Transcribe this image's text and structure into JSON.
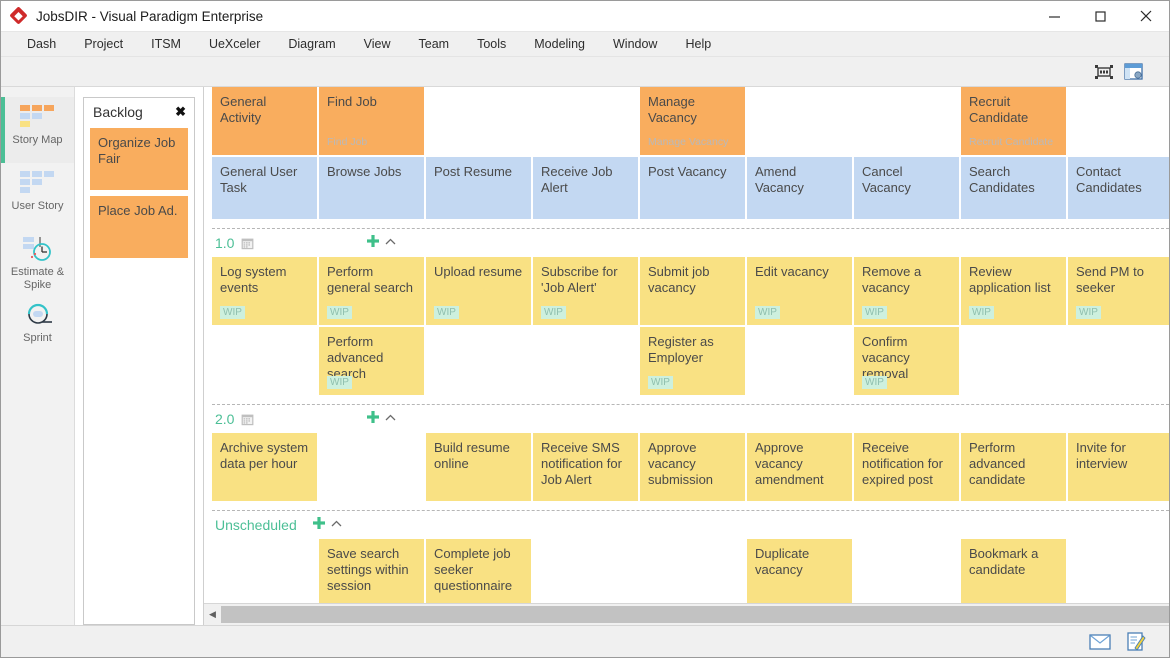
{
  "window": {
    "title": "JobsDIR - Visual Paradigm Enterprise",
    "logo_icon": "vp-diamond-logo",
    "minimize_icon": "minimize-icon",
    "maximize_icon": "maximize-icon",
    "close_icon": "close-icon"
  },
  "menubar": {
    "items": [
      {
        "label": "Dash"
      },
      {
        "label": "Project"
      },
      {
        "label": "ITSM"
      },
      {
        "label": "UeXceler"
      },
      {
        "label": "Diagram"
      },
      {
        "label": "View"
      },
      {
        "label": "Team"
      },
      {
        "label": "Tools"
      },
      {
        "label": "Modeling"
      },
      {
        "label": "Window"
      },
      {
        "label": "Help"
      }
    ]
  },
  "toolbar": {
    "icons": [
      {
        "name": "fit-to-screen-icon"
      },
      {
        "name": "open-specification-icon"
      }
    ]
  },
  "rail": {
    "items": [
      {
        "label": "Story Map",
        "icon": "story-map-icon",
        "active": true
      },
      {
        "label": "User Story",
        "icon": "user-story-icon",
        "active": false
      },
      {
        "label": "Estimate & Spike",
        "icon": "estimate-spike-icon",
        "active": false
      },
      {
        "label": "Sprint",
        "icon": "sprint-icon",
        "active": false
      }
    ]
  },
  "backlog": {
    "title": "Backlog",
    "close_icon": "close-icon",
    "cards": [
      {
        "label": "Organize Job Fair"
      },
      {
        "label": "Place Job Ad."
      }
    ]
  },
  "board": {
    "activity_row": [
      {
        "label": "General Activity",
        "sub": ""
      },
      {
        "label": "Find Job",
        "sub": "Find Job"
      },
      {
        "label": "",
        "sub": ""
      },
      {
        "label": "",
        "sub": ""
      },
      {
        "label": "Manage Vacancy",
        "sub": "Manage Vacancy"
      },
      {
        "label": "",
        "sub": ""
      },
      {
        "label": "",
        "sub": ""
      },
      {
        "label": "Recruit Candidate",
        "sub": "Recruit Candidate"
      },
      {
        "label": "",
        "sub": ""
      }
    ],
    "task_row": [
      {
        "label": "General User Task"
      },
      {
        "label": "Browse Jobs"
      },
      {
        "label": "Post Resume"
      },
      {
        "label": "Receive Job Alert"
      },
      {
        "label": "Post Vacancy"
      },
      {
        "label": "Amend Vacancy"
      },
      {
        "label": "Cancel Vacancy"
      },
      {
        "label": "Search Candidates"
      },
      {
        "label": "Contact Candidates"
      }
    ],
    "sprints": [
      {
        "name": "1.0",
        "calendar_icon": "calendar-icon",
        "add_icon": "add-icon",
        "collapse_icon": "chevron-up-icon",
        "rows": [
          [
            {
              "label": "Log system events",
              "wip": "WIP"
            },
            {
              "label": "Perform general search",
              "wip": "WIP"
            },
            {
              "label": "Upload resume",
              "wip": "WIP"
            },
            {
              "label": "Subscribe for 'Job Alert'",
              "wip": "WIP"
            },
            {
              "label": "Submit job vacancy",
              "wip": ""
            },
            {
              "label": "Edit vacancy",
              "wip": "WIP"
            },
            {
              "label": "Remove a vacancy",
              "wip": "WIP"
            },
            {
              "label": "Review application list",
              "wip": "WIP"
            },
            {
              "label": "Send PM to seeker",
              "wip": "WIP"
            }
          ],
          [
            {
              "label": "",
              "wip": ""
            },
            {
              "label": "Perform advanced search",
              "wip": "WIP"
            },
            {
              "label": "",
              "wip": ""
            },
            {
              "label": "",
              "wip": ""
            },
            {
              "label": "Register as Employer",
              "wip": "WIP"
            },
            {
              "label": "",
              "wip": ""
            },
            {
              "label": "Confirm vacancy removal",
              "wip": "WIP"
            },
            {
              "label": "",
              "wip": ""
            },
            {
              "label": "",
              "wip": ""
            }
          ]
        ]
      },
      {
        "name": "2.0",
        "calendar_icon": "calendar-icon",
        "add_icon": "add-icon",
        "collapse_icon": "chevron-up-icon",
        "rows": [
          [
            {
              "label": "Archive system data per hour",
              "wip": ""
            },
            {
              "label": "",
              "wip": ""
            },
            {
              "label": "Build resume online",
              "wip": ""
            },
            {
              "label": "Receive SMS notification for Job Alert",
              "wip": ""
            },
            {
              "label": "Approve vacancy submission",
              "wip": ""
            },
            {
              "label": "Approve vacancy amendment",
              "wip": ""
            },
            {
              "label": "Receive notification for expired post",
              "wip": ""
            },
            {
              "label": "Perform advanced candidate",
              "wip": ""
            },
            {
              "label": "Invite for interview",
              "wip": ""
            }
          ]
        ]
      },
      {
        "name": "Unscheduled",
        "calendar_icon": "",
        "add_icon": "add-icon",
        "collapse_icon": "chevron-up-icon",
        "rows": [
          [
            {
              "label": "",
              "wip": ""
            },
            {
              "label": "Save search settings within session",
              "wip": ""
            },
            {
              "label": "Complete job seeker questionnaire",
              "wip": ""
            },
            {
              "label": "",
              "wip": ""
            },
            {
              "label": "",
              "wip": ""
            },
            {
              "label": "Duplicate vacancy",
              "wip": ""
            },
            {
              "label": "",
              "wip": ""
            },
            {
              "label": "Bookmark a candidate",
              "wip": ""
            },
            {
              "label": "",
              "wip": ""
            }
          ]
        ]
      }
    ],
    "hscroll": {
      "left_arrow_icon": "scroll-left-icon",
      "right_arrow_icon": "scroll-right-icon"
    }
  },
  "statusbar": {
    "icons": [
      {
        "name": "message-icon"
      },
      {
        "name": "notes-icon"
      }
    ]
  },
  "colors": {
    "activity": "#f9ad5e",
    "task": "#c3d8f2",
    "story": "#f9e183",
    "accent": "#4cbf96",
    "wip_bg": "#cdf0de"
  }
}
